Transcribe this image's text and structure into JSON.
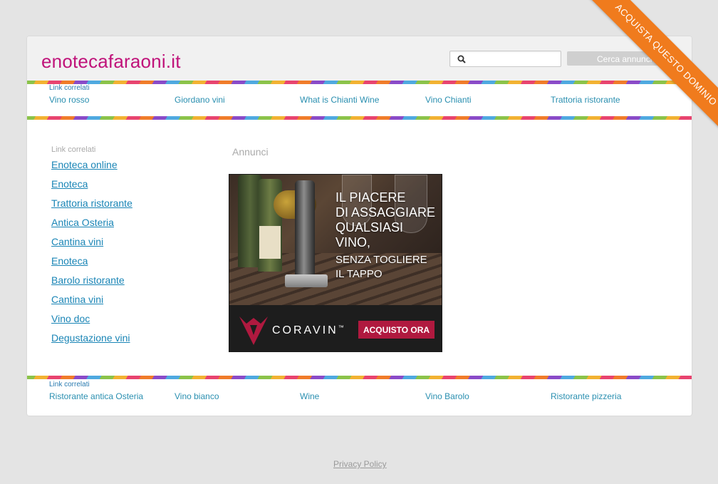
{
  "header": {
    "domain": "enotecafaraoni.it",
    "search_placeholder": "",
    "search_button_label": "Cerca annunci"
  },
  "top_links": {
    "caption": "Link correlati",
    "items": [
      "Vino rosso",
      "Giordano vini",
      "What is Chianti Wine",
      "Vino Chianti",
      "Trattoria ristorante"
    ]
  },
  "sidebar": {
    "caption": "Link correlati",
    "items": [
      "Enoteca online",
      "Enoteca",
      "Trattoria ristorante",
      "Antica Osteria",
      "Cantina vini",
      "Enoteca",
      "Barolo ristorante",
      "Cantina vini",
      "Vino doc",
      "Degustazione vini"
    ]
  },
  "ads": {
    "caption": "Annunci",
    "banner": {
      "headline_lines": [
        "IL PIACERE",
        "DI ASSAGGIARE",
        "QUALSIASI",
        "VINO,"
      ],
      "sub_lines": [
        "SENZA TOGLIERE",
        "IL TAPPO"
      ],
      "brand": "CORAVIN",
      "brand_mark": "™",
      "cta": "ACQUISTO ORA",
      "cta_color": "#b0193f"
    }
  },
  "bottom_links": {
    "caption": "Link correlati",
    "items": [
      "Ristorante antica Osteria",
      "Vino bianco",
      "Wine",
      "Vino Barolo",
      "Ristorante pizzeria"
    ]
  },
  "footer": {
    "privacy_label": "Privacy Policy"
  },
  "ribbon": {
    "label": "ACQUISTA QUESTO DOMINIO",
    "color": "#f07b1d"
  },
  "colors": {
    "domain_title": "#c0137a",
    "link": "#1a85b6",
    "background": "#e4e4e4"
  }
}
